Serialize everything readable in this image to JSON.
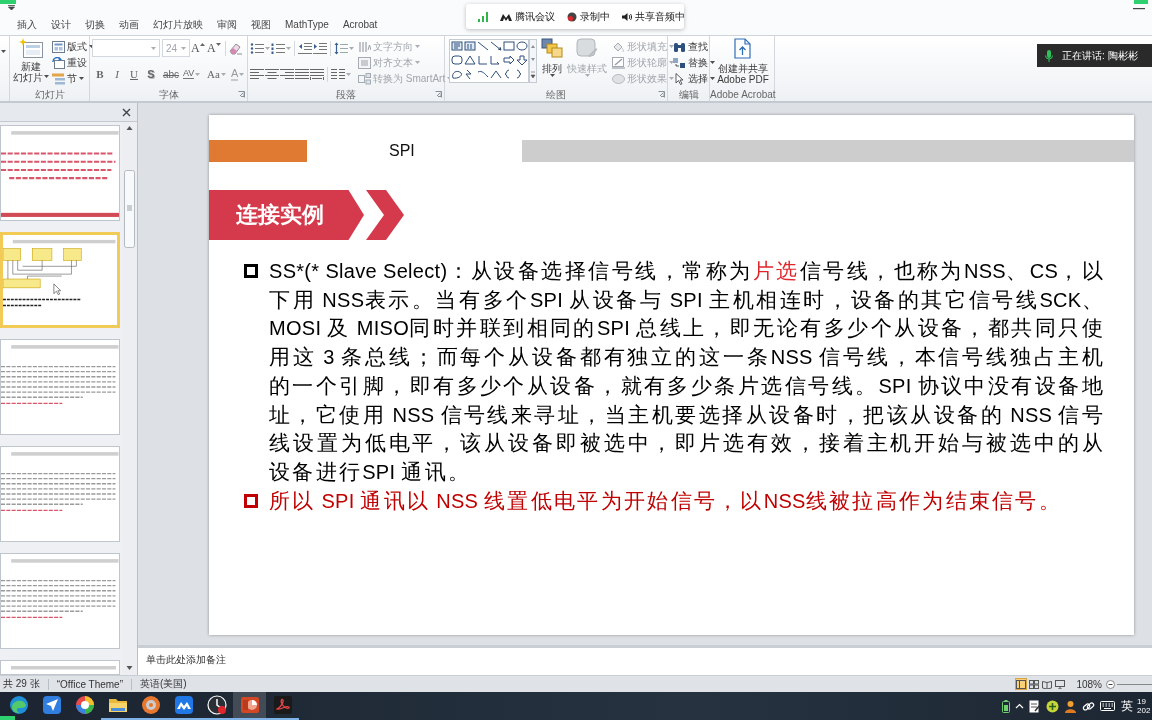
{
  "ribbon_tabs": [
    {
      "label": "插入",
      "selected": false
    },
    {
      "label": "设计",
      "selected": false
    },
    {
      "label": "切换",
      "selected": false
    },
    {
      "label": "动画",
      "selected": false
    },
    {
      "label": "幻灯片放映",
      "selected": false
    },
    {
      "label": "审阅",
      "selected": false
    },
    {
      "label": "视图",
      "selected": false
    },
    {
      "label": "MathType",
      "selected": false
    },
    {
      "label": "Acrobat",
      "selected": false
    }
  ],
  "meeting_bar": {
    "items": [
      {
        "kind": "signal"
      },
      {
        "kind": "app",
        "label": "腾讯会议"
      },
      {
        "kind": "recording",
        "label": "录制中"
      },
      {
        "kind": "audio",
        "label": "共享音频中"
      }
    ]
  },
  "speaker_notice": {
    "label": "正在讲话: 陶彬彬"
  },
  "ribbon": {
    "groups": [
      {
        "kind": "slides",
        "title": "幻灯片",
        "launcher": false,
        "new_slide": {
          "lines": [
            "新建",
            "幻灯片"
          ],
          "dropdown": true
        },
        "commands": [
          {
            "label": "版式",
            "dropdown": true,
            "disabled": false
          },
          {
            "label": "重设",
            "dropdown": false,
            "disabled": false
          },
          {
            "label": "节",
            "dropdown": true,
            "disabled": false
          }
        ]
      },
      {
        "kind": "font",
        "title": "字体",
        "launcher": true,
        "font_size": {
          "value": "24",
          "disabled": true
        },
        "size_buttons": [
          {
            "label": "A"
          },
          {
            "label": "A"
          }
        ],
        "format_buttons": [
          {
            "label": "B",
            "dropdown": false
          },
          {
            "label": "I",
            "dropdown": false
          },
          {
            "label": "U",
            "dropdown": false
          },
          {
            "label": "S",
            "dropdown": false
          },
          {
            "label": "abc",
            "dropdown": false
          },
          {
            "label": "AV",
            "dropdown": true
          },
          {
            "label": "Aa",
            "dropdown": true
          },
          {
            "label": "A",
            "dropdown": true
          }
        ]
      },
      {
        "kind": "paragraph",
        "title": "段落",
        "launcher": true,
        "commands": [
          {
            "label": "文字方向",
            "dropdown": true,
            "disabled": true
          },
          {
            "label": "对齐文本",
            "dropdown": true,
            "disabled": true
          },
          {
            "label": "转换为 SmartArt",
            "dropdown": true,
            "disabled": true
          }
        ]
      },
      {
        "kind": "drawing",
        "title": "绘图",
        "launcher": true,
        "arrange": {
          "label": "排列",
          "dropdown": true,
          "disabled": false
        },
        "quick_styles": {
          "label": "快速样式",
          "dropdown": true,
          "disabled": true
        },
        "commands": [
          {
            "label": "形状填充",
            "dropdown": true,
            "disabled": true
          },
          {
            "label": "形状轮廓",
            "dropdown": true,
            "disabled": true
          },
          {
            "label": "形状效果",
            "dropdown": true,
            "disabled": true
          }
        ]
      },
      {
        "kind": "editing",
        "title": "编辑",
        "launcher": false,
        "commands": [
          {
            "label": "查找",
            "dropdown": false,
            "disabled": false
          },
          {
            "label": "替换",
            "dropdown": true,
            "disabled": false
          },
          {
            "label": "选择",
            "dropdown": true,
            "disabled": false
          }
        ]
      },
      {
        "kind": "acrobat",
        "title": "Adobe Acrobat",
        "launcher": false,
        "button": {
          "lines": [
            "创建并共享",
            "Adobe PDF"
          ]
        }
      }
    ]
  },
  "slide_pane": {
    "thumbnails": [
      {
        "kind": "red-text",
        "selected": false
      },
      {
        "kind": "diagram",
        "selected": true
      },
      {
        "kind": "text",
        "selected": false
      },
      {
        "kind": "text",
        "selected": false
      },
      {
        "kind": "text",
        "selected": false
      },
      {
        "kind": "chart",
        "selected": false
      }
    ]
  },
  "slide": {
    "header": {
      "title": "SPI"
    },
    "banner": {
      "label": "连接实例"
    },
    "bullets": [
      {
        "color": "#000000",
        "runs": [
          {
            "text": "SS*(* Slave Select)：从设备选择信号线，常称为",
            "highlight": false
          },
          {
            "text": "片选",
            "highlight": true
          },
          {
            "text": "信号线，也称为NSS、CS，以下用 NSS表示。当有多个SPI 从设备与 SPI 主机相连时，设备的其它信号线SCK、MOSI 及 MISO同时并联到相同的SPI 总线上，即无论有多少个从设备，都共同只使用这 3 条总线；而每个从设备都有独立的这一条NSS 信号线，本信号线独占主机的一个引脚，即有多少个从设备，就有多少条片选信号线。SPI 协议中没有设备地址，它使用 NSS 信号线来寻址，当主机要选择从设备时，把该从设备的 NSS 信号线设置为低电平，该从设备即被选中，即片选有效，接着主机开始与被选中的从设备进行SPI 通讯。",
            "highlight": false
          }
        ]
      },
      {
        "color": "#c00000",
        "runs": [
          {
            "text": "所以 SPI 通讯以 NSS 线置低电平为开始信号，以NSS线被拉高作为结束信号。",
            "highlight": false
          }
        ]
      }
    ]
  },
  "notes": {
    "placeholder": "单击此处添加备注"
  },
  "status_bar": {
    "slide_count": "共 29 张",
    "theme": "“Office Theme”",
    "language": "英语(美国)",
    "views": [
      {
        "selected": true
      },
      {
        "selected": false
      },
      {
        "selected": false
      },
      {
        "selected": false
      }
    ],
    "zoom": "108%"
  },
  "taskbar": {
    "apps": [
      {
        "running": false,
        "selected": false
      },
      {
        "running": false,
        "selected": false
      },
      {
        "running": false,
        "selected": false
      },
      {
        "running": true,
        "selected": false
      },
      {
        "running": true,
        "selected": false
      },
      {
        "running": true,
        "selected": false
      },
      {
        "running": true,
        "selected": false
      },
      {
        "running": true,
        "selected": true
      },
      {
        "running": true,
        "selected": false
      }
    ],
    "ime": "英",
    "clock": {
      "time": "19",
      "date": "202"
    }
  }
}
